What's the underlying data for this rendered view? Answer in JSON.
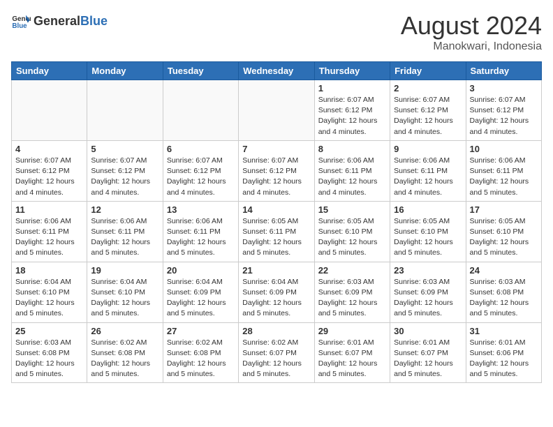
{
  "header": {
    "logo_general": "General",
    "logo_blue": "Blue",
    "title": "August 2024",
    "subtitle": "Manokwari, Indonesia"
  },
  "weekdays": [
    "Sunday",
    "Monday",
    "Tuesday",
    "Wednesday",
    "Thursday",
    "Friday",
    "Saturday"
  ],
  "weeks": [
    [
      {
        "day": "",
        "info": ""
      },
      {
        "day": "",
        "info": ""
      },
      {
        "day": "",
        "info": ""
      },
      {
        "day": "",
        "info": ""
      },
      {
        "day": "1",
        "info": "Sunrise: 6:07 AM\nSunset: 6:12 PM\nDaylight: 12 hours and 4 minutes."
      },
      {
        "day": "2",
        "info": "Sunrise: 6:07 AM\nSunset: 6:12 PM\nDaylight: 12 hours and 4 minutes."
      },
      {
        "day": "3",
        "info": "Sunrise: 6:07 AM\nSunset: 6:12 PM\nDaylight: 12 hours and 4 minutes."
      }
    ],
    [
      {
        "day": "4",
        "info": "Sunrise: 6:07 AM\nSunset: 6:12 PM\nDaylight: 12 hours and 4 minutes."
      },
      {
        "day": "5",
        "info": "Sunrise: 6:07 AM\nSunset: 6:12 PM\nDaylight: 12 hours and 4 minutes."
      },
      {
        "day": "6",
        "info": "Sunrise: 6:07 AM\nSunset: 6:12 PM\nDaylight: 12 hours and 4 minutes."
      },
      {
        "day": "7",
        "info": "Sunrise: 6:07 AM\nSunset: 6:12 PM\nDaylight: 12 hours and 4 minutes."
      },
      {
        "day": "8",
        "info": "Sunrise: 6:06 AM\nSunset: 6:11 PM\nDaylight: 12 hours and 4 minutes."
      },
      {
        "day": "9",
        "info": "Sunrise: 6:06 AM\nSunset: 6:11 PM\nDaylight: 12 hours and 4 minutes."
      },
      {
        "day": "10",
        "info": "Sunrise: 6:06 AM\nSunset: 6:11 PM\nDaylight: 12 hours and 5 minutes."
      }
    ],
    [
      {
        "day": "11",
        "info": "Sunrise: 6:06 AM\nSunset: 6:11 PM\nDaylight: 12 hours and 5 minutes."
      },
      {
        "day": "12",
        "info": "Sunrise: 6:06 AM\nSunset: 6:11 PM\nDaylight: 12 hours and 5 minutes."
      },
      {
        "day": "13",
        "info": "Sunrise: 6:06 AM\nSunset: 6:11 PM\nDaylight: 12 hours and 5 minutes."
      },
      {
        "day": "14",
        "info": "Sunrise: 6:05 AM\nSunset: 6:11 PM\nDaylight: 12 hours and 5 minutes."
      },
      {
        "day": "15",
        "info": "Sunrise: 6:05 AM\nSunset: 6:10 PM\nDaylight: 12 hours and 5 minutes."
      },
      {
        "day": "16",
        "info": "Sunrise: 6:05 AM\nSunset: 6:10 PM\nDaylight: 12 hours and 5 minutes."
      },
      {
        "day": "17",
        "info": "Sunrise: 6:05 AM\nSunset: 6:10 PM\nDaylight: 12 hours and 5 minutes."
      }
    ],
    [
      {
        "day": "18",
        "info": "Sunrise: 6:04 AM\nSunset: 6:10 PM\nDaylight: 12 hours and 5 minutes."
      },
      {
        "day": "19",
        "info": "Sunrise: 6:04 AM\nSunset: 6:10 PM\nDaylight: 12 hours and 5 minutes."
      },
      {
        "day": "20",
        "info": "Sunrise: 6:04 AM\nSunset: 6:09 PM\nDaylight: 12 hours and 5 minutes."
      },
      {
        "day": "21",
        "info": "Sunrise: 6:04 AM\nSunset: 6:09 PM\nDaylight: 12 hours and 5 minutes."
      },
      {
        "day": "22",
        "info": "Sunrise: 6:03 AM\nSunset: 6:09 PM\nDaylight: 12 hours and 5 minutes."
      },
      {
        "day": "23",
        "info": "Sunrise: 6:03 AM\nSunset: 6:09 PM\nDaylight: 12 hours and 5 minutes."
      },
      {
        "day": "24",
        "info": "Sunrise: 6:03 AM\nSunset: 6:08 PM\nDaylight: 12 hours and 5 minutes."
      }
    ],
    [
      {
        "day": "25",
        "info": "Sunrise: 6:03 AM\nSunset: 6:08 PM\nDaylight: 12 hours and 5 minutes."
      },
      {
        "day": "26",
        "info": "Sunrise: 6:02 AM\nSunset: 6:08 PM\nDaylight: 12 hours and 5 minutes."
      },
      {
        "day": "27",
        "info": "Sunrise: 6:02 AM\nSunset: 6:08 PM\nDaylight: 12 hours and 5 minutes."
      },
      {
        "day": "28",
        "info": "Sunrise: 6:02 AM\nSunset: 6:07 PM\nDaylight: 12 hours and 5 minutes."
      },
      {
        "day": "29",
        "info": "Sunrise: 6:01 AM\nSunset: 6:07 PM\nDaylight: 12 hours and 5 minutes."
      },
      {
        "day": "30",
        "info": "Sunrise: 6:01 AM\nSunset: 6:07 PM\nDaylight: 12 hours and 5 minutes."
      },
      {
        "day": "31",
        "info": "Sunrise: 6:01 AM\nSunset: 6:06 PM\nDaylight: 12 hours and 5 minutes."
      }
    ]
  ]
}
